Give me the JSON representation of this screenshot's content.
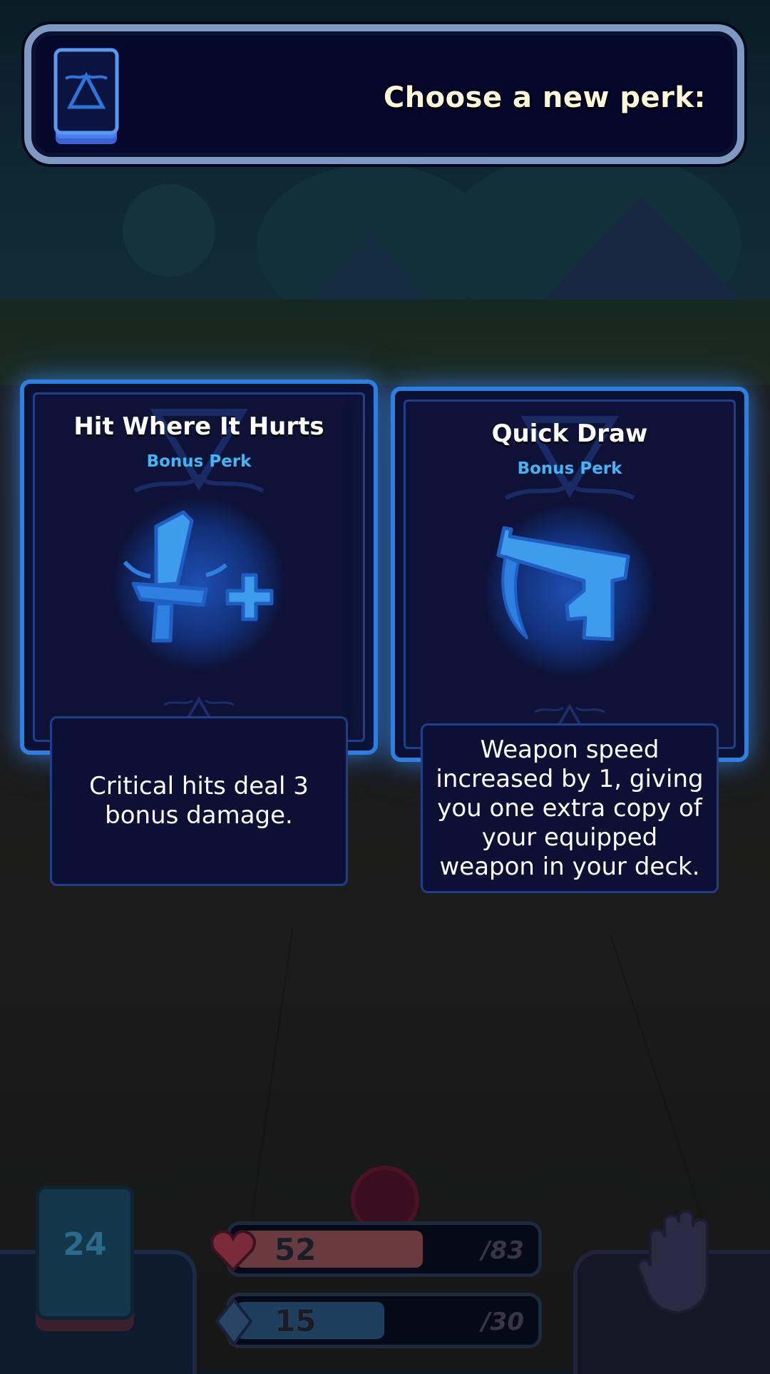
{
  "header": {
    "title": "Choose a new perk:"
  },
  "cards": [
    {
      "title": "Hit Where It Hurts",
      "subtitle": "Bonus Perk",
      "icon": "sword-plus-icon",
      "description": "Critical hits deal 3 bonus damage."
    },
    {
      "title": "Quick Draw",
      "subtitle": "Bonus Perk",
      "icon": "pistol-icon",
      "description": "Weapon speed increased by 1, giving you one extra copy of your equipped weapon in your deck."
    }
  ],
  "hud": {
    "deck_count": "24",
    "health": {
      "value": "52",
      "max": "/83",
      "fraction": 0.63,
      "icon": "heart-icon"
    },
    "energy": {
      "value": "15",
      "max": "/30",
      "fraction": 0.5,
      "icon": "crystal-icon"
    },
    "hand_icon": "hand-icon",
    "enemy_icon": "enemy-head-icon"
  },
  "colors": {
    "accent": "#2f7fe0",
    "subtitle": "#43b5f4",
    "banner_border": "#7e9ac2",
    "health": "#e2444f",
    "energy": "#2f8fe8"
  }
}
